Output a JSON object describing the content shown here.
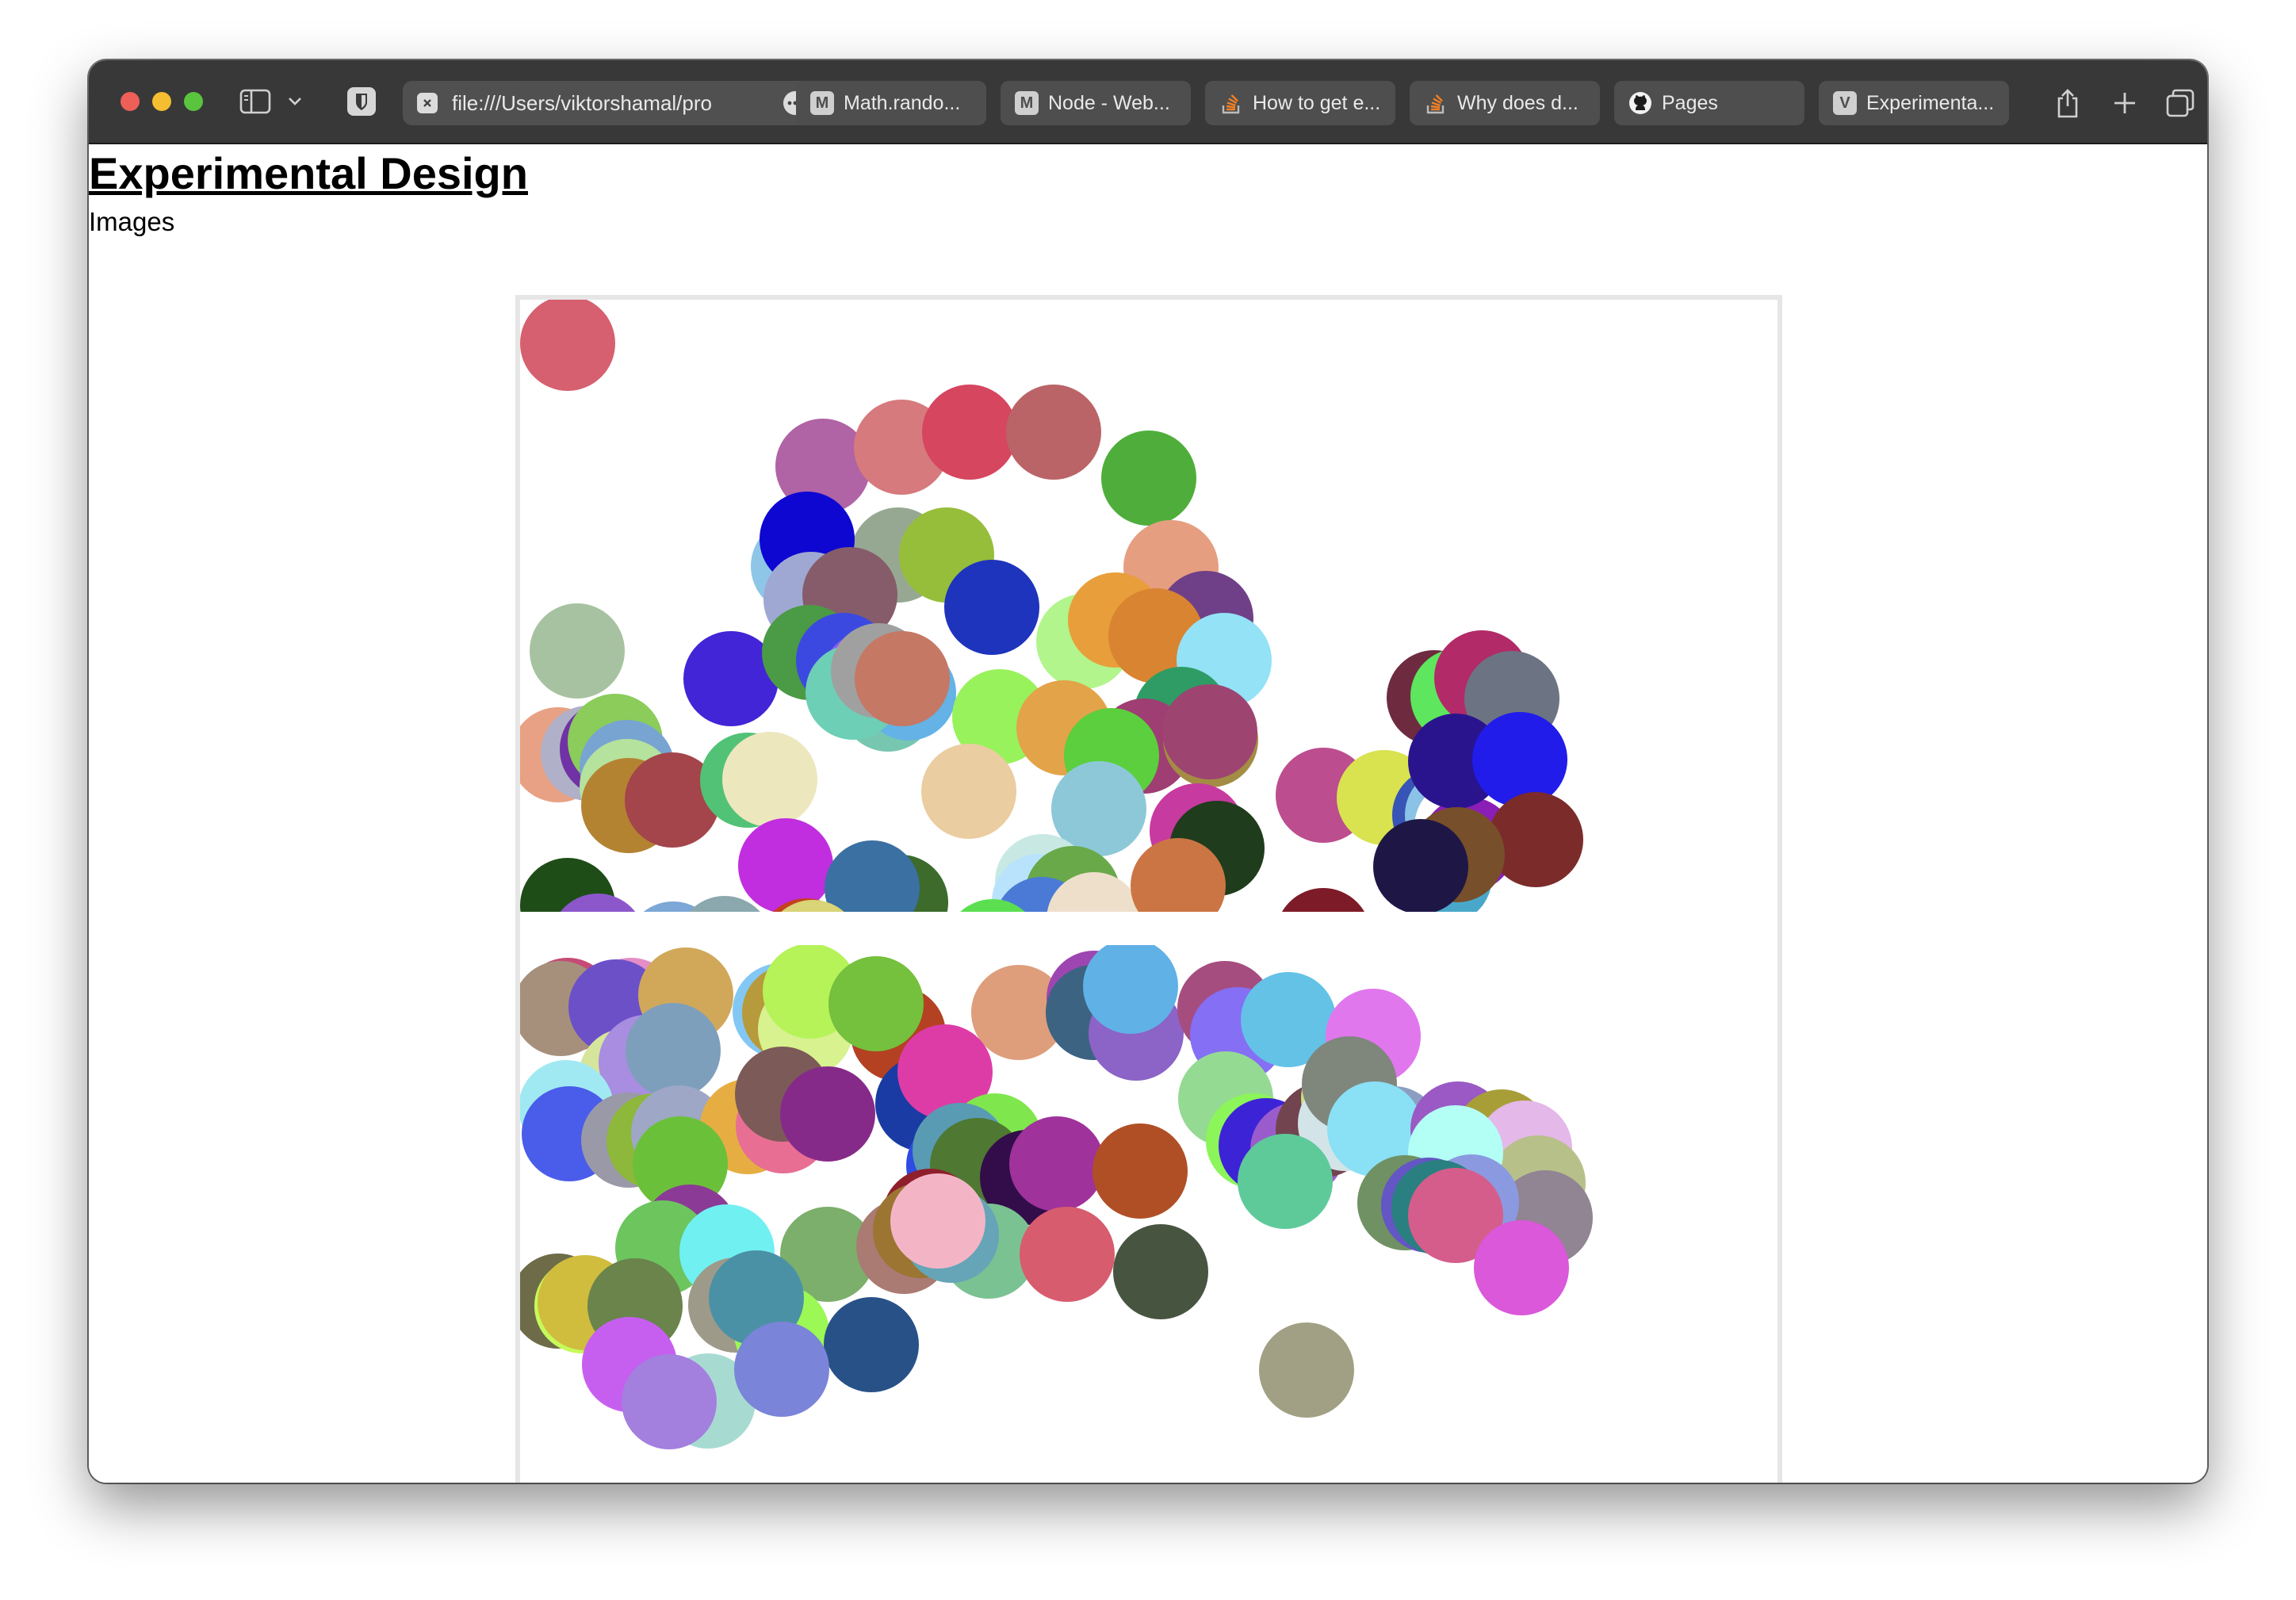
{
  "browser": {
    "url": "file:///Users/viktorshamal/pro",
    "tabs": [
      {
        "favicon": "M",
        "favicon_kind": "letter",
        "title": "Math.rando..."
      },
      {
        "favicon": "M",
        "favicon_kind": "letter",
        "title": "Node - Web..."
      },
      {
        "favicon": "stackoverflow-icon",
        "favicon_kind": "icon",
        "title": "How to get e..."
      },
      {
        "favicon": "stackoverflow-icon",
        "favicon_kind": "icon",
        "title": "Why does d..."
      },
      {
        "favicon": "github-icon",
        "favicon_kind": "icon",
        "title": "Pages"
      },
      {
        "favicon": "V",
        "favicon_kind": "letter",
        "title": "Experimenta..."
      }
    ],
    "icons": [
      "sidebar-icon",
      "chevron-down-icon",
      "shield-icon",
      "more-icon",
      "share-icon",
      "plus-icon",
      "tab-overview-icon"
    ]
  },
  "page": {
    "title": "Experimental Design",
    "subtitle": "Images"
  },
  "colors": {
    "toolbar": "#383838",
    "tab": "#4e4e4e",
    "frame_border": "#e6e6e6"
  },
  "images": [
    {
      "name": "canvas-image-1",
      "circles": [
        [
          "#d6606f",
          0,
          -5
        ],
        [
          "#b063a5",
          322,
          150
        ],
        [
          "#d67a7d",
          421,
          126
        ],
        [
          "#d6465f",
          507,
          107
        ],
        [
          "#ba6468",
          613,
          107
        ],
        [
          "#4fae3b",
          733,
          165
        ],
        [
          "#8ec6e8",
          291,
          276
        ],
        [
          "#b8e070",
          327,
          287
        ],
        [
          "#97a892",
          417,
          262
        ],
        [
          "#96be3a",
          478,
          262
        ],
        [
          "#0e07d2",
          302,
          242
        ],
        [
          "#9fa8d2",
          307,
          318
        ],
        [
          "#865c6a",
          356,
          312
        ],
        [
          "#1f34bc",
          535,
          328
        ],
        [
          "#e69e80",
          761,
          278
        ],
        [
          "#6f4088",
          805,
          342
        ],
        [
          "#b1f58c",
          651,
          371
        ],
        [
          "#e89f3b",
          691,
          344
        ],
        [
          "#d98431",
          742,
          364
        ],
        [
          "#a7c2a0",
          12,
          383
        ],
        [
          "#4125d7",
          206,
          418
        ],
        [
          "#4b9a45",
          305,
          385
        ],
        [
          "#3c49e0",
          348,
          395
        ],
        [
          "#8b5cf5",
          380,
          418
        ],
        [
          "#77c7b0",
          404,
          450
        ],
        [
          "#64b2e6",
          430,
          436
        ],
        [
          "#6dcfb6",
          360,
          435
        ],
        [
          "#a0a0a0",
          392,
          408
        ],
        [
          "#c57864",
          422,
          418
        ],
        [
          "#98f25c",
          545,
          466
        ],
        [
          "#e3a349",
          626,
          480
        ],
        [
          "#93e2f6",
          828,
          395
        ],
        [
          "#2f9c65",
          774,
          463
        ],
        [
          "#9e3e72",
          727,
          503
        ],
        [
          "#5bcf3d",
          686,
          515
        ],
        [
          "#a38c44",
          811,
          495
        ],
        [
          "#9d4471",
          810,
          485
        ],
        [
          "#e8a184",
          -12,
          514
        ],
        [
          "#b0b0c8",
          26,
          512
        ],
        [
          "#7032a4",
          50,
          507
        ],
        [
          "#8bcc5a",
          60,
          497
        ],
        [
          "#78a4d2",
          75,
          530
        ],
        [
          "#b5e29d",
          75,
          554
        ],
        [
          "#b48332",
          77,
          578
        ],
        [
          "#a3454a",
          132,
          571
        ],
        [
          "#52c277",
          227,
          546
        ],
        [
          "#ede7be",
          255,
          545
        ],
        [
          "#eacda0",
          506,
          560
        ],
        [
          "#8dc8d8",
          670,
          582
        ],
        [
          "#bc4d8e",
          953,
          565
        ],
        [
          "#d9e24f",
          1030,
          568
        ],
        [
          "#3655b6",
          1100,
          590
        ],
        [
          "#8bc3e6",
          1116,
          590
        ],
        [
          "#eab575",
          1162,
          534
        ],
        [
          "#ffffff",
          1128,
          605
        ],
        [
          "#8b1eb6",
          1136,
          627
        ],
        [
          "#6e2b3f",
          1093,
          442
        ],
        [
          "#5de65e",
          1123,
          440
        ],
        [
          "#b22a68",
          1153,
          417
        ],
        [
          "#6c7382",
          1191,
          443
        ],
        [
          "#29148d",
          1120,
          522
        ],
        [
          "#211cea",
          1201,
          520
        ],
        [
          "#49a8ca",
          1106,
          668
        ],
        [
          "#c02edf",
          275,
          654
        ],
        [
          "#1f4d18",
          0,
          704
        ],
        [
          "#c73a9f",
          794,
          610
        ],
        [
          "#1f3c1c",
          819,
          632
        ],
        [
          "#7c2b2b",
          1221,
          621
        ],
        [
          "#774f2a",
          1122,
          640
        ],
        [
          "#3c6b2c",
          420,
          700
        ],
        [
          "#3b70a2",
          384,
          682
        ],
        [
          "#8c57cb",
          38,
          749
        ],
        [
          "#7ca7d6",
          133,
          759
        ],
        [
          "#8aa8ad",
          198,
          752
        ],
        [
          "#c4401f",
          301,
          755
        ],
        [
          "#d8d477",
          309,
          757
        ],
        [
          "#c8e8e4",
          599,
          674
        ],
        [
          "#b9e3fd",
          595,
          699
        ],
        [
          "#69a94a",
          637,
          689
        ],
        [
          "#4b7ad6",
          598,
          728
        ],
        [
          "#eedfcb",
          664,
          722
        ],
        [
          "#cc7544",
          770,
          679
        ],
        [
          "#5bdf51",
          536,
          756
        ],
        [
          "#669c95",
          814,
          788
        ],
        [
          "#a2bf3a",
          889,
          783
        ],
        [
          "#7d1c28",
          953,
          742
        ],
        [
          "#1e1746",
          1076,
          655
        ],
        [
          "#6e1e8d",
          1014,
          780
        ],
        [
          "#a6bf7e",
          814,
          800
        ]
      ]
    },
    {
      "name": "canvas-image-2",
      "circles": [
        [
          "#c64b76",
          0,
          16
        ],
        [
          "#e48dc7",
          80,
          16
        ],
        [
          "#a6907c",
          -9,
          20
        ],
        [
          "#6c50c8",
          61,
          18
        ],
        [
          "#d1a85a",
          149,
          3
        ],
        [
          "#83c7f5",
          268,
          23
        ],
        [
          "#b79a3b",
          280,
          25
        ],
        [
          "#d7f28e",
          300,
          46
        ],
        [
          "#b5f359",
          306,
          -2
        ],
        [
          "#b34122",
          417,
          52
        ],
        [
          "#75c03c",
          389,
          14
        ],
        [
          "#de9e7b",
          569,
          25
        ],
        [
          "#9d46b1",
          664,
          7
        ],
        [
          "#3c6382",
          663,
          25
        ],
        [
          "#8c63c7",
          717,
          51
        ],
        [
          "#60b1e6",
          710,
          -8
        ],
        [
          "#a64d80",
          829,
          20
        ],
        [
          "#856ff5",
          845,
          53
        ],
        [
          "#63c2e6",
          909,
          34
        ],
        [
          "#e077ed",
          1016,
          55
        ],
        [
          "#d5e59c",
          74,
          105
        ],
        [
          "#a88de1",
          99,
          88
        ],
        [
          "#7e9fbc",
          133,
          73
        ],
        [
          "#cf5d74",
          260,
          152
        ],
        [
          "#a1e9f2",
          -2,
          145
        ],
        [
          "#4a5cea",
          2,
          178
        ],
        [
          "#9a99a7",
          77,
          186
        ],
        [
          "#8db83b",
          109,
          187
        ],
        [
          "#9ea7c6",
          140,
          177
        ],
        [
          "#e6ae42",
          227,
          169
        ],
        [
          "#6bc03a",
          142,
          216
        ],
        [
          "#e86e94",
          272,
          168
        ],
        [
          "#7b5a58",
          271,
          128
        ],
        [
          "#862a8a",
          328,
          153
        ],
        [
          "#1a3ba3",
          448,
          140
        ],
        [
          "#dd3ca7",
          476,
          100
        ],
        [
          "#80e64e",
          539,
          187
        ],
        [
          "#2e4be2",
          487,
          218
        ],
        [
          "#5a9bb4",
          495,
          199
        ],
        [
          "#4f7832",
          517,
          218
        ],
        [
          "#320d4a",
          580,
          233
        ],
        [
          "#a0329b",
          617,
          216
        ],
        [
          "#b04f26",
          722,
          225
        ],
        [
          "#95da93",
          830,
          134
        ],
        [
          "#8bf55a",
          865,
          187
        ],
        [
          "#3d23d6",
          881,
          193
        ],
        [
          "#9a5ccc",
          921,
          198
        ],
        [
          "#72444f",
          953,
          173
        ],
        [
          "#cce07a",
          985,
          133
        ],
        [
          "#d3e4e9",
          981,
          165
        ],
        [
          "#8b9ec1",
          1042,
          178
        ],
        [
          "#7f867c",
          986,
          115
        ],
        [
          "#5eca9a",
          905,
          238
        ],
        [
          "#8ae0f5",
          1018,
          172
        ],
        [
          "#9a59c4",
          1123,
          172
        ],
        [
          "#a89e38",
          1178,
          182
        ],
        [
          "#e4b8e8",
          1207,
          196
        ],
        [
          "#b8c08a",
          1224,
          240
        ],
        [
          "#b3fff5",
          1120,
          202
        ],
        [
          "#918493",
          1233,
          284
        ],
        [
          "#709164",
          1056,
          265
        ],
        [
          "#6456c4",
          1086,
          268
        ],
        [
          "#8b9ae0",
          1140,
          264
        ],
        [
          "#2a8080",
          1099,
          271
        ],
        [
          "#d55d8b",
          1120,
          281
        ],
        [
          "#8b3b95",
          154,
          302
        ],
        [
          "#6dc55e",
          120,
          322
        ],
        [
          "#7baf6b",
          328,
          330
        ],
        [
          "#a97b73",
          424,
          320
        ],
        [
          "#8f1f2b",
          457,
          282
        ],
        [
          "#9b7531",
          445,
          300
        ],
        [
          "#7bc292",
          531,
          326
        ],
        [
          "#65a5b7",
          484,
          306
        ],
        [
          "#f3b5c6",
          467,
          288
        ],
        [
          "#d75c6e",
          630,
          330
        ],
        [
          "#475540",
          748,
          352
        ],
        [
          "#da58d9",
          1203,
          347
        ],
        [
          "#71f0f2",
          201,
          327
        ],
        [
          "#6e6c48",
          -12,
          389
        ],
        [
          "#c6fa5a",
          18,
          395
        ],
        [
          "#d0bd3e",
          22,
          391
        ],
        [
          "#9e9a89",
          212,
          394
        ],
        [
          "#9cf855",
          270,
          429
        ],
        [
          "#6a844c",
          85,
          395
        ],
        [
          "#4b91a6",
          238,
          385
        ],
        [
          "#285188",
          383,
          444
        ],
        [
          "#c65ff0",
          78,
          469
        ],
        [
          "#a7dbd1",
          177,
          515
        ],
        [
          "#a37fde",
          128,
          516
        ],
        [
          "#7a84d8",
          270,
          475
        ],
        [
          "#a1a084",
          932,
          476
        ]
      ]
    }
  ]
}
